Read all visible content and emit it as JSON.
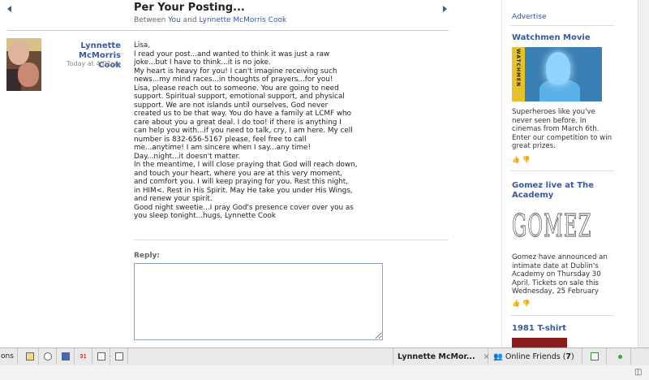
{
  "header": {
    "title": "Per Your Posting...",
    "between_prefix": "Between",
    "participant_you": "You",
    "and_word": "and",
    "participant_other": "Lynnette McMorris Cook"
  },
  "message": {
    "author_line1": "Lynnette McMorris",
    "author_line2": "Cook",
    "timestamp": "Today at 4:02am",
    "lines": [
      "Lisa,",
      "I read your post...and wanted to think it was just a raw",
      "joke...but I have to think...it is no joke.",
      "My heart is heavy for you! I can't imagine receiving such",
      "news...my mind races...in thoughts of prayers...for you!",
      "Lisa, please reach out to someone. You are going to need",
      "support. Spiritual support, emotional support, and physical",
      "support. We are not islands until ourselves, God never",
      "created us to be that way. You do have a family at LCMF who",
      "care about you a great deal. I do too! if there is anything I",
      "can help you with...if you need to talk, cry, I am here. My cell",
      "number is 832-656-5167 please, feel free to call",
      "me...anytime! I am sincere when I say...any time!",
      "Day...night...it doesn't matter.",
      "In the meantime, I will close praying that God will reach down,",
      "and touch your heart, where you are at this very moment,",
      "and comfort you. I will keep praying for you. Rest this night,",
      "in HIM<. Rest in His Spirit. May He take you under His Wings,",
      "and renew your spirit.",
      "Good night sweetie...I pray God's presence cover over you as",
      "you sleep tonight...hugs, Lynnette Cook"
    ]
  },
  "reply": {
    "label": "Reply:",
    "value": ""
  },
  "sidebar": {
    "advertise": "Advertise",
    "ads": [
      {
        "title": "Watchmen Movie",
        "image_text": "WATCHMEN",
        "text_lines": [
          "Superheroes like you've",
          "never seen before. In",
          "cinemas from March 6th.",
          "Enter our competition to win",
          "great prizes."
        ]
      },
      {
        "title_line1": "Gomez live at The",
        "title_line2": "Academy",
        "image_text": "GOMEZ",
        "text_lines": [
          "Gomez have announced an",
          "intimate date at Dublin's",
          "Academy on Thursday 30",
          "April. Tickets on sale this",
          "Wednesday, 25 February"
        ]
      },
      {
        "title": "1981 T-shirt"
      }
    ]
  },
  "bottombar": {
    "left_fragment": "ons",
    "chat_tab": "Lynnette McMor...",
    "close": "×",
    "online_friends_label": "Online Friends (",
    "online_friends_count": "7",
    "online_friends_close": ")",
    "calendar_icon_text": "31"
  }
}
